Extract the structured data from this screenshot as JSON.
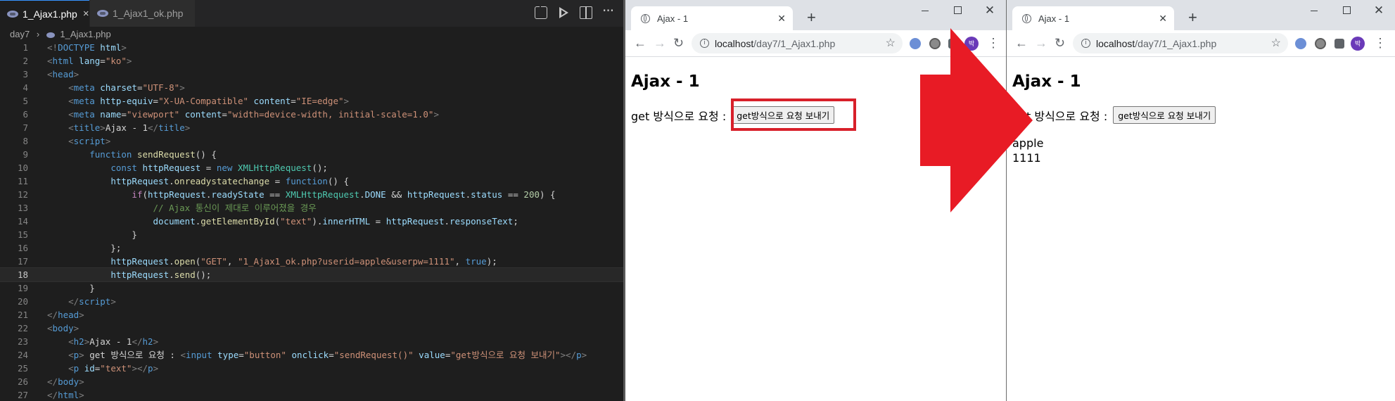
{
  "editor": {
    "tabs": [
      {
        "label": "1_Ajax1.php",
        "active": true,
        "close": "×"
      },
      {
        "label": "1_Ajax1_ok.php",
        "active": false
      }
    ],
    "breadcrumb": {
      "folder": "day7",
      "sep": "›",
      "file": "1_Ajax1.php"
    },
    "current_line": 18,
    "lines": [
      {
        "n": "1"
      },
      {
        "n": "2"
      },
      {
        "n": "3"
      },
      {
        "n": "4"
      },
      {
        "n": "5"
      },
      {
        "n": "6"
      },
      {
        "n": "7"
      },
      {
        "n": "8"
      },
      {
        "n": "9"
      },
      {
        "n": "10"
      },
      {
        "n": "11"
      },
      {
        "n": "12"
      },
      {
        "n": "13"
      },
      {
        "n": "14"
      },
      {
        "n": "15"
      },
      {
        "n": "16"
      },
      {
        "n": "17"
      },
      {
        "n": "18"
      },
      {
        "n": "19"
      },
      {
        "n": "20"
      },
      {
        "n": "21"
      },
      {
        "n": "22"
      },
      {
        "n": "23"
      },
      {
        "n": "24"
      },
      {
        "n": "25"
      },
      {
        "n": "26"
      },
      {
        "n": "27"
      }
    ],
    "code": [
      [
        [
          "t-bracket",
          "<!"
        ],
        [
          "t-tag",
          "DOCTYPE"
        ],
        [
          "t-txt",
          " "
        ],
        [
          "t-attr",
          "html"
        ],
        [
          "t-bracket",
          ">"
        ]
      ],
      [
        [
          "t-bracket",
          "<"
        ],
        [
          "t-tag",
          "html"
        ],
        [
          "t-txt",
          " "
        ],
        [
          "t-attr",
          "lang"
        ],
        [
          "t-txt",
          "="
        ],
        [
          "t-str",
          "\"ko\""
        ],
        [
          "t-bracket",
          ">"
        ]
      ],
      [
        [
          "t-bracket",
          "<"
        ],
        [
          "t-tag",
          "head"
        ],
        [
          "t-bracket",
          ">"
        ]
      ],
      [
        [
          "t-txt",
          "    "
        ],
        [
          "t-bracket",
          "<"
        ],
        [
          "t-tag",
          "meta"
        ],
        [
          "t-txt",
          " "
        ],
        [
          "t-attr",
          "charset"
        ],
        [
          "t-txt",
          "="
        ],
        [
          "t-str",
          "\"UTF-8\""
        ],
        [
          "t-bracket",
          ">"
        ]
      ],
      [
        [
          "t-txt",
          "    "
        ],
        [
          "t-bracket",
          "<"
        ],
        [
          "t-tag",
          "meta"
        ],
        [
          "t-txt",
          " "
        ],
        [
          "t-attr",
          "http-equiv"
        ],
        [
          "t-txt",
          "="
        ],
        [
          "t-str",
          "\"X-UA-Compatible\""
        ],
        [
          "t-txt",
          " "
        ],
        [
          "t-attr",
          "content"
        ],
        [
          "t-txt",
          "="
        ],
        [
          "t-str",
          "\"IE=edge\""
        ],
        [
          "t-bracket",
          ">"
        ]
      ],
      [
        [
          "t-txt",
          "    "
        ],
        [
          "t-bracket",
          "<"
        ],
        [
          "t-tag",
          "meta"
        ],
        [
          "t-txt",
          " "
        ],
        [
          "t-attr",
          "name"
        ],
        [
          "t-txt",
          "="
        ],
        [
          "t-str",
          "\"viewport\""
        ],
        [
          "t-txt",
          " "
        ],
        [
          "t-attr",
          "content"
        ],
        [
          "t-txt",
          "="
        ],
        [
          "t-str",
          "\"width=device-width, initial-scale=1.0\""
        ],
        [
          "t-bracket",
          ">"
        ]
      ],
      [
        [
          "t-txt",
          "    "
        ],
        [
          "t-bracket",
          "<"
        ],
        [
          "t-tag",
          "title"
        ],
        [
          "t-bracket",
          ">"
        ],
        [
          "t-txt",
          "Ajax - 1"
        ],
        [
          "t-bracket",
          "</"
        ],
        [
          "t-tag",
          "title"
        ],
        [
          "t-bracket",
          ">"
        ]
      ],
      [
        [
          "t-txt",
          "    "
        ],
        [
          "t-bracket",
          "<"
        ],
        [
          "t-tag",
          "script"
        ],
        [
          "t-bracket",
          ">"
        ]
      ],
      [
        [
          "t-txt",
          "        "
        ],
        [
          "t-kw",
          "function"
        ],
        [
          "t-txt",
          " "
        ],
        [
          "t-fn",
          "sendRequest"
        ],
        [
          "t-txt",
          "() {"
        ]
      ],
      [
        [
          "t-txt",
          "            "
        ],
        [
          "t-kw",
          "const"
        ],
        [
          "t-txt",
          " "
        ],
        [
          "t-var",
          "httpRequest"
        ],
        [
          "t-txt",
          " = "
        ],
        [
          "t-kw",
          "new"
        ],
        [
          "t-txt",
          " "
        ],
        [
          "t-cls",
          "XMLHttpRequest"
        ],
        [
          "t-txt",
          "();"
        ]
      ],
      [
        [
          "t-txt",
          "            "
        ],
        [
          "t-var",
          "httpRequest"
        ],
        [
          "t-txt",
          "."
        ],
        [
          "t-fn",
          "onreadystatechange"
        ],
        [
          "t-txt",
          " = "
        ],
        [
          "t-kw",
          "function"
        ],
        [
          "t-txt",
          "() {"
        ]
      ],
      [
        [
          "t-txt",
          "                "
        ],
        [
          "t-ctl",
          "if"
        ],
        [
          "t-txt",
          "("
        ],
        [
          "t-var",
          "httpRequest"
        ],
        [
          "t-txt",
          "."
        ],
        [
          "t-var",
          "readyState"
        ],
        [
          "t-txt",
          " == "
        ],
        [
          "t-cls",
          "XMLHttpRequest"
        ],
        [
          "t-txt",
          "."
        ],
        [
          "t-var",
          "DONE"
        ],
        [
          "t-txt",
          " && "
        ],
        [
          "t-var",
          "httpRequest"
        ],
        [
          "t-txt",
          "."
        ],
        [
          "t-var",
          "status"
        ],
        [
          "t-txt",
          " == "
        ],
        [
          "t-num",
          "200"
        ],
        [
          "t-txt",
          ") {"
        ]
      ],
      [
        [
          "t-txt",
          "                    "
        ],
        [
          "t-cmt",
          "// Ajax 통신이 제대로 이루어졌을 경우"
        ]
      ],
      [
        [
          "t-txt",
          "                    "
        ],
        [
          "t-var",
          "document"
        ],
        [
          "t-txt",
          "."
        ],
        [
          "t-fn",
          "getElementById"
        ],
        [
          "t-txt",
          "("
        ],
        [
          "t-str",
          "\"text\""
        ],
        [
          "t-txt",
          ")."
        ],
        [
          "t-var",
          "innerHTML"
        ],
        [
          "t-txt",
          " = "
        ],
        [
          "t-var",
          "httpRequest"
        ],
        [
          "t-txt",
          "."
        ],
        [
          "t-var",
          "responseText"
        ],
        [
          "t-txt",
          ";"
        ]
      ],
      [
        [
          "t-txt",
          "                }"
        ]
      ],
      [
        [
          "t-txt",
          "            };"
        ]
      ],
      [
        [
          "t-txt",
          "            "
        ],
        [
          "t-var",
          "httpRequest"
        ],
        [
          "t-txt",
          "."
        ],
        [
          "t-fn",
          "open"
        ],
        [
          "t-txt",
          "("
        ],
        [
          "t-str",
          "\"GET\""
        ],
        [
          "t-txt",
          ", "
        ],
        [
          "t-str",
          "\"1_Ajax1_ok.php?userid=apple&userpw=1111\""
        ],
        [
          "t-txt",
          ", "
        ],
        [
          "t-kw",
          "true"
        ],
        [
          "t-txt",
          ");"
        ]
      ],
      [
        [
          "t-txt",
          "            "
        ],
        [
          "t-var",
          "httpRequest"
        ],
        [
          "t-txt",
          "."
        ],
        [
          "t-fn",
          "send"
        ],
        [
          "t-txt",
          "();"
        ]
      ],
      [
        [
          "t-txt",
          "        }"
        ]
      ],
      [
        [
          "t-txt",
          "    "
        ],
        [
          "t-bracket",
          "</"
        ],
        [
          "t-tag",
          "script"
        ],
        [
          "t-bracket",
          ">"
        ]
      ],
      [
        [
          "t-bracket",
          "</"
        ],
        [
          "t-tag",
          "head"
        ],
        [
          "t-bracket",
          ">"
        ]
      ],
      [
        [
          "t-bracket",
          "<"
        ],
        [
          "t-tag",
          "body"
        ],
        [
          "t-bracket",
          ">"
        ]
      ],
      [
        [
          "t-txt",
          "    "
        ],
        [
          "t-bracket",
          "<"
        ],
        [
          "t-tag",
          "h2"
        ],
        [
          "t-bracket",
          ">"
        ],
        [
          "t-txt",
          "Ajax - 1"
        ],
        [
          "t-bracket",
          "</"
        ],
        [
          "t-tag",
          "h2"
        ],
        [
          "t-bracket",
          ">"
        ]
      ],
      [
        [
          "t-txt",
          "    "
        ],
        [
          "t-bracket",
          "<"
        ],
        [
          "t-tag",
          "p"
        ],
        [
          "t-bracket",
          ">"
        ],
        [
          "t-txt",
          " get 방식으로 요청 : "
        ],
        [
          "t-bracket",
          "<"
        ],
        [
          "t-tag",
          "input"
        ],
        [
          "t-txt",
          " "
        ],
        [
          "t-attr",
          "type"
        ],
        [
          "t-txt",
          "="
        ],
        [
          "t-str",
          "\"button\""
        ],
        [
          "t-txt",
          " "
        ],
        [
          "t-attr",
          "onclick"
        ],
        [
          "t-txt",
          "="
        ],
        [
          "t-str",
          "\"sendRequest()\""
        ],
        [
          "t-txt",
          " "
        ],
        [
          "t-attr",
          "value"
        ],
        [
          "t-txt",
          "="
        ],
        [
          "t-str",
          "\"get방식으로 요청 보내기\""
        ],
        [
          "t-bracket",
          "></"
        ],
        [
          "t-tag",
          "p"
        ],
        [
          "t-bracket",
          ">"
        ]
      ],
      [
        [
          "t-txt",
          "    "
        ],
        [
          "t-bracket",
          "<"
        ],
        [
          "t-tag",
          "p"
        ],
        [
          "t-txt",
          " "
        ],
        [
          "t-attr",
          "id"
        ],
        [
          "t-txt",
          "="
        ],
        [
          "t-str",
          "\"text\""
        ],
        [
          "t-bracket",
          "></"
        ],
        [
          "t-tag",
          "p"
        ],
        [
          "t-bracket",
          ">"
        ]
      ],
      [
        [
          "t-bracket",
          "</"
        ],
        [
          "t-tag",
          "body"
        ],
        [
          "t-bracket",
          ">"
        ]
      ],
      [
        [
          "t-bracket",
          "</"
        ],
        [
          "t-tag",
          "html"
        ],
        [
          "t-bracket",
          ">"
        ]
      ]
    ]
  },
  "browser_left": {
    "tab_title": "Ajax - 1",
    "url_host": "localhost",
    "url_path": "/day7/1_Ajax1.php",
    "avatar_letter": "박",
    "heading": "Ajax - 1",
    "prompt": "get 방식으로 요청 :",
    "button": "get방식으로 요청 보내기",
    "highlight_color": "#d8202a"
  },
  "browser_right": {
    "tab_title": "Ajax - 1",
    "url_host": "localhost",
    "url_path": "/day7/1_Ajax1.php",
    "avatar_letter": "박",
    "heading": "Ajax - 1",
    "prompt": "get 방식으로 요청 :",
    "button": "get방식으로 요청 보내기",
    "response_lines": [
      "apple",
      "1111"
    ]
  },
  "arrow_color": "#e81b25"
}
